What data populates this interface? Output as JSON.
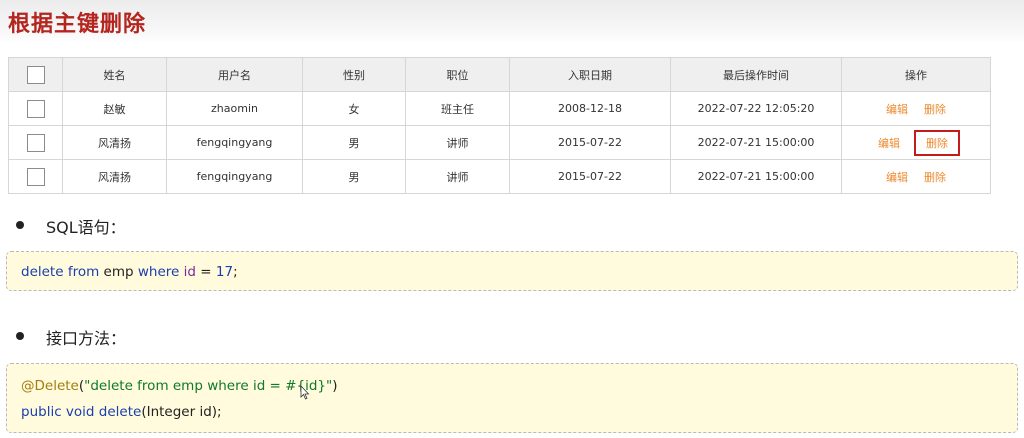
{
  "page_title": "根据主键删除",
  "table": {
    "headers": [
      "姓名",
      "用户名",
      "性别",
      "职位",
      "入职日期",
      "最后操作时间",
      "操作"
    ],
    "rows": [
      {
        "name": "赵敏",
        "username": "zhaomin",
        "gender": "女",
        "position": "班主任",
        "entry_date": "2008-12-18",
        "last_op": "2022-07-22 12:05:20",
        "edit": "编辑",
        "delete": "删除"
      },
      {
        "name": "风清扬",
        "username": "fengqingyang",
        "gender": "男",
        "position": "讲师",
        "entry_date": "2015-07-22",
        "last_op": "2022-07-21 15:00:00",
        "edit": "编辑",
        "delete": "删除"
      },
      {
        "name": "风清扬",
        "username": "fengqingyang",
        "gender": "男",
        "position": "讲师",
        "entry_date": "2015-07-22",
        "last_op": "2022-07-21 15:00:00",
        "edit": "编辑",
        "delete": "删除"
      }
    ]
  },
  "sql_section": {
    "label": "SQL语句：",
    "code": {
      "t1": "delete",
      "t2": "from",
      "t3": "emp",
      "t4": "where",
      "t5": "id",
      "t6": "=",
      "t7": "17",
      "t8": ";"
    }
  },
  "method_section": {
    "label": "接口方法：",
    "line1": {
      "anno": "@Delete",
      "open": "(",
      "str": "\"delete from emp where id = #{id}\"",
      "close": ")"
    },
    "line2": {
      "t1": "public",
      "t2": "void",
      "t3": "delete",
      "t4": "(Integer id);"
    }
  },
  "colors": {
    "title": "#b3251e",
    "action": "#ed8a2e",
    "highlight": "#c21d1d",
    "code_bg": "#fffbdc"
  }
}
